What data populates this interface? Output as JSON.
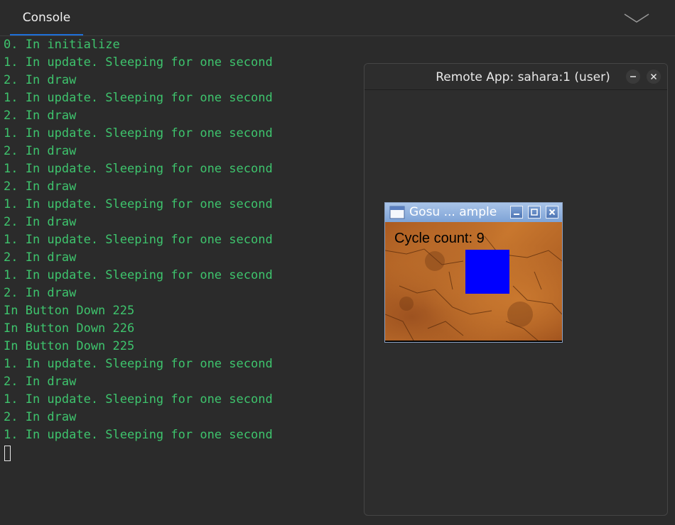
{
  "tabs": [
    {
      "label": "Console"
    }
  ],
  "console": {
    "lines": [
      "0. In initialize",
      "1. In update. Sleeping for one second",
      "2. In draw",
      "1. In update. Sleeping for one second",
      "2. In draw",
      "1. In update. Sleeping for one second",
      "2. In draw",
      "1. In update. Sleeping for one second",
      "2. In draw",
      "1. In update. Sleeping for one second",
      "2. In draw",
      "1. In update. Sleeping for one second",
      "2. In draw",
      "1. In update. Sleeping for one second",
      "2. In draw",
      "In Button Down 225",
      "In Button Down 226",
      "In Button Down 225",
      "1. In update. Sleeping for one second",
      "2. In draw",
      "1. In update. Sleeping for one second",
      "2. In draw",
      "1. In update. Sleeping for one second"
    ],
    "text_color": "#3ec46d"
  },
  "remote_window": {
    "title": "Remote App: sahara:1 (user)",
    "minimize_icon": "minus-icon",
    "close_icon": "close-icon"
  },
  "gosu_window": {
    "title": "Gosu ... ample",
    "window_icon": "window-icon",
    "cycle_text": "Cycle count: 9",
    "square_color": "#0000ff"
  },
  "colors": {
    "accent": "#1e6fd9",
    "background": "#2b2b2b"
  }
}
